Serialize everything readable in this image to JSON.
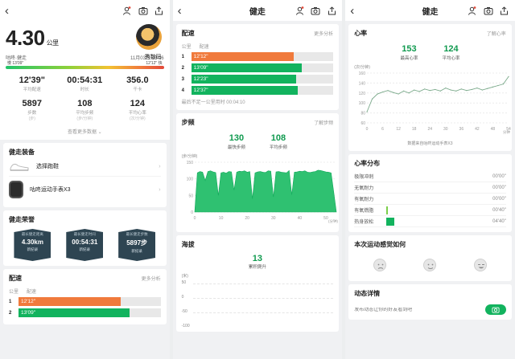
{
  "app": {
    "title": "健走"
  },
  "icons": {
    "back": "back-icon",
    "coach": "coach-icon",
    "camera": "camera-icon",
    "share": "share-icon"
  },
  "colors": {
    "accent": "#12b35e",
    "dark_green": "#109a4f",
    "orange": "#f07a3c",
    "badge_bg": "#2e4552"
  },
  "summary": {
    "distance": "4.30",
    "distance_unit": "公里",
    "username": "秀数码",
    "activity": "咕咚·健走",
    "date": "11月03日 15:06",
    "pace_tag_left": "慢 13'09\"",
    "pace_tag_right": "12'12\" 快",
    "stats": [
      {
        "value": "12'39\"",
        "label": "平均配速",
        "unit": ""
      },
      {
        "value": "00:54:31",
        "label": "时长",
        "unit": ""
      },
      {
        "value": "356.0",
        "label": "千卡",
        "unit": ""
      },
      {
        "value": "5897",
        "label": "步数",
        "unit": "(步)"
      },
      {
        "value": "108",
        "label": "平均步频",
        "unit": "(步/分钟)"
      },
      {
        "value": "124",
        "label": "平均心率",
        "unit": "(次/分钟)"
      }
    ],
    "more_data": "查看更多数据"
  },
  "equipment": {
    "title": "健走装备",
    "items": [
      {
        "label": "选择跑鞋"
      },
      {
        "label": "咕咚运动手表X3"
      }
    ]
  },
  "honors": {
    "title": "健走荣誉",
    "badges": [
      {
        "title": "最长健走距离",
        "value": "4.30km",
        "note": "新纪录"
      },
      {
        "title": "最长健走时间",
        "value": "00:54:31",
        "note": "新纪录"
      },
      {
        "title": "最长健走步数",
        "value": "5897步",
        "note": "新纪录"
      }
    ]
  },
  "pace": {
    "title": "配速",
    "more": "更多分析",
    "col_km": "公里",
    "col_pace": "配速",
    "rows": [
      {
        "km": "1",
        "pace": "12'12\"",
        "fill": 0.72,
        "color": "#f07a3c"
      },
      {
        "km": "2",
        "pace": "13'09\"",
        "fill": 0.78,
        "color": "#12b35e"
      },
      {
        "km": "3",
        "pace": "12'23\"",
        "fill": 0.74,
        "color": "#12b35e"
      },
      {
        "km": "4",
        "pace": "12'37\"",
        "fill": 0.75,
        "color": "#12b35e"
      }
    ],
    "footnote": "最后不足一公里用时 00:04:10"
  },
  "cadence": {
    "title": "步频",
    "info": "了解步频",
    "max_value": "130",
    "max_label": "最快步频",
    "avg_value": "108",
    "avg_label": "平均步频",
    "y_unit": "(步/分钟)",
    "x_unit": "(分钟)",
    "chart_data": {
      "type": "area",
      "xlabel": "(分钟)",
      "ylabel": "(步/分钟)",
      "ylim": [
        0,
        150
      ],
      "xlim": [
        0,
        54
      ],
      "y_ticks": [
        0,
        50,
        100,
        150
      ],
      "x_ticks": [
        0,
        10,
        20,
        30,
        40,
        50
      ],
      "x": [
        0,
        1,
        2,
        3,
        4,
        5,
        6,
        7,
        8,
        9,
        10,
        11,
        12,
        13,
        14,
        15,
        16,
        17,
        18,
        19,
        20,
        21,
        22,
        23,
        24,
        25,
        26,
        27,
        28,
        29,
        30,
        31,
        32,
        33,
        34,
        35,
        36,
        37,
        38,
        39,
        40,
        41,
        42,
        43,
        44,
        45,
        46,
        47,
        48,
        49,
        50,
        51,
        52,
        53,
        54
      ],
      "values": [
        0,
        118,
        122,
        120,
        95,
        122,
        124,
        121,
        119,
        50,
        118,
        120,
        117,
        122,
        121,
        66,
        120,
        123,
        122,
        124,
        120,
        122,
        40,
        118,
        121,
        122,
        120,
        119,
        124,
        123,
        45,
        121,
        122,
        120,
        119,
        118,
        125,
        52,
        120,
        121,
        123,
        122,
        124,
        120,
        119,
        121,
        122,
        126,
        125,
        123,
        121,
        120,
        118,
        60,
        0
      ]
    }
  },
  "altitude": {
    "title": "海拔",
    "value": "13",
    "label": "累积爬升",
    "y_unit": "(米)",
    "y_ticks": [
      "50",
      "0",
      "-50",
      "-100"
    ]
  },
  "heart": {
    "title": "心率",
    "info": "了解心率",
    "max_value": "153",
    "max_label": "最高心率",
    "avg_value": "124",
    "avg_label": "平均心率",
    "y_unit": "(次/分钟)",
    "x_unit": "分钟",
    "source": "数据来自咕咚运动手表X3",
    "chart_data": {
      "type": "line",
      "xlabel": "分钟",
      "ylabel": "(次/分钟)",
      "ylim": [
        60,
        160
      ],
      "xlim": [
        0,
        54
      ],
      "y_ticks": [
        60,
        80,
        100,
        120,
        140,
        160
      ],
      "x_ticks": [
        0,
        6,
        12,
        18,
        24,
        30,
        36,
        42,
        48,
        54
      ],
      "x": [
        0,
        2,
        4,
        6,
        8,
        10,
        12,
        14,
        16,
        18,
        20,
        22,
        24,
        26,
        28,
        30,
        32,
        34,
        36,
        38,
        40,
        42,
        44,
        46,
        48,
        50,
        52,
        54
      ],
      "values": [
        82,
        108,
        118,
        122,
        125,
        121,
        118,
        124,
        120,
        126,
        123,
        128,
        125,
        127,
        124,
        130,
        126,
        124,
        128,
        125,
        127,
        130,
        126,
        129,
        132,
        135,
        138,
        153
      ]
    }
  },
  "zones": {
    "title": "心率分布",
    "rows": [
      {
        "label": "极限冲刺",
        "time": "00'00\"",
        "fill": 0
      },
      {
        "label": "无氧耐力",
        "time": "00'00\"",
        "fill": 0
      },
      {
        "label": "有氧耐力",
        "time": "00'00\"",
        "fill": 0
      },
      {
        "label": "有氧燃脂",
        "time": "00'40\"",
        "fill": 0.02
      },
      {
        "label": "热身放松",
        "time": "04'40\"",
        "fill": 0.08
      }
    ]
  },
  "feeling": {
    "title": "本次运动感觉如何"
  },
  "feed": {
    "title": "动态详情",
    "placeholder": "发布动态让你的好友看到吧"
  }
}
